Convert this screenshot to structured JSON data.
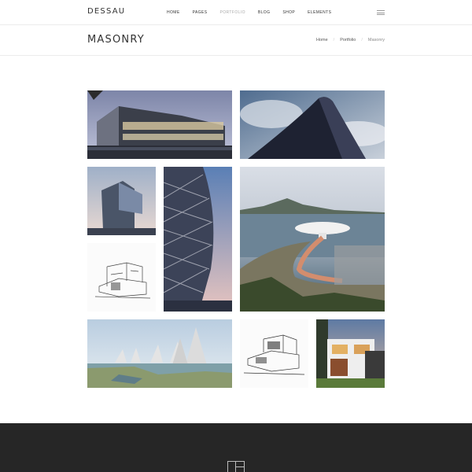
{
  "header": {
    "logo": "DESSAU",
    "nav": [
      {
        "label": "HOME",
        "active": false
      },
      {
        "label": "PAGES",
        "active": false
      },
      {
        "label": "PORTFOLIO",
        "active": true
      },
      {
        "label": "BLOG",
        "active": false
      },
      {
        "label": "SHOP",
        "active": false
      },
      {
        "label": "ELEMENTS",
        "active": false
      }
    ],
    "menu_icon": "hamburger-icon"
  },
  "title_bar": {
    "title": "MASONRY",
    "breadcrumb": {
      "home": "Home",
      "parent": "Portfolio",
      "current": "Masonry",
      "separator": "/"
    }
  },
  "gallery": {
    "items": [
      {
        "name": "portfolio-item-glass-building-night"
      },
      {
        "name": "portfolio-item-curved-facade-sky"
      },
      {
        "name": "portfolio-item-cantilever-tower"
      },
      {
        "name": "portfolio-item-lattice-tower"
      },
      {
        "name": "portfolio-item-cliff-museum"
      },
      {
        "name": "portfolio-item-house-sketch"
      },
      {
        "name": "portfolio-item-waterfront-towers"
      },
      {
        "name": "portfolio-item-villa-sketch"
      },
      {
        "name": "portfolio-item-modern-house-dusk"
      }
    ]
  },
  "footer": {
    "logo_icon": "dessau-logo-icon",
    "background": "#262626"
  }
}
